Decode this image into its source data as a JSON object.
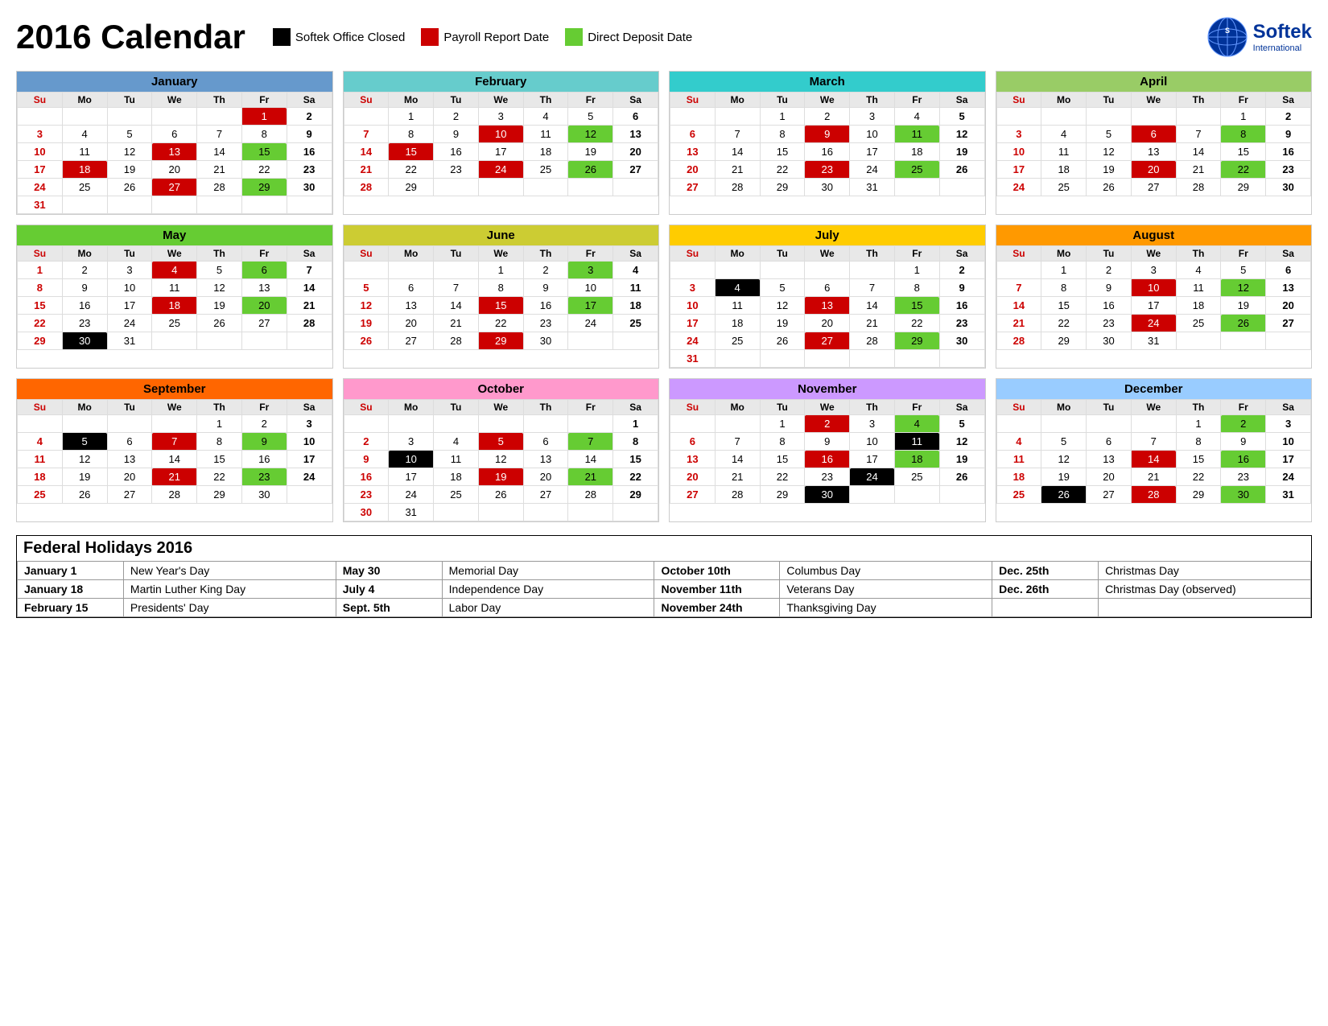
{
  "header": {
    "title": "2016 Calendar",
    "legend": [
      {
        "label": "Softek Office Closed",
        "color_class": "legend-black"
      },
      {
        "label": "Payroll Report Date",
        "color_class": "legend-red"
      },
      {
        "label": "Direct Deposit Date",
        "color_class": "legend-green"
      }
    ],
    "logo_text": "Softek",
    "logo_sub": "International"
  },
  "months": [
    {
      "name": "January",
      "class": "month-jan",
      "days_header": [
        "Su",
        "Mo",
        "Tu",
        "We",
        "Th",
        "Fr",
        "Sa"
      ],
      "weeks": [
        [
          "",
          "",
          "",
          "",
          "",
          "1r",
          "2b"
        ],
        [
          "3s",
          "4",
          "5",
          "6",
          "7",
          "8",
          "9b"
        ],
        [
          "10s",
          "11",
          "12",
          "13r",
          "14",
          "15g",
          "16b"
        ],
        [
          "17s",
          "18r",
          "19",
          "20",
          "21",
          "22",
          "23b"
        ],
        [
          "24s",
          "25",
          "26",
          "27r",
          "28",
          "29g",
          "30b"
        ],
        [
          "31s",
          "",
          "",
          "",
          "",
          "",
          ""
        ]
      ]
    },
    {
      "name": "February",
      "class": "month-feb",
      "days_header": [
        "Su",
        "Mo",
        "Tu",
        "We",
        "Th",
        "Fr",
        "Sa"
      ],
      "weeks": [
        [
          "",
          "1",
          "2",
          "3",
          "4",
          "5",
          "6b"
        ],
        [
          "7s",
          "8",
          "9",
          "10r",
          "11",
          "12g",
          "13b"
        ],
        [
          "14s",
          "15r",
          "16",
          "17",
          "18",
          "19",
          "20b"
        ],
        [
          "21s",
          "22",
          "23",
          "24r",
          "25",
          "26g",
          "27b"
        ],
        [
          "28s",
          "29",
          "",
          "",
          "",
          "",
          ""
        ]
      ]
    },
    {
      "name": "March",
      "class": "month-mar",
      "days_header": [
        "Su",
        "Mo",
        "Tu",
        "We",
        "Th",
        "Fr",
        "Sa"
      ],
      "weeks": [
        [
          "",
          "",
          "1",
          "2",
          "3",
          "4",
          "5b"
        ],
        [
          "6s",
          "7",
          "8",
          "9r",
          "10",
          "11g",
          "12b"
        ],
        [
          "13s",
          "14",
          "15",
          "16",
          "17",
          "18",
          "19b"
        ],
        [
          "20s",
          "21",
          "22",
          "23r",
          "24",
          "25g",
          "26b"
        ],
        [
          "27s",
          "28",
          "29",
          "30",
          "31",
          "",
          ""
        ]
      ]
    },
    {
      "name": "April",
      "class": "month-apr",
      "days_header": [
        "Su",
        "Mo",
        "Tu",
        "We",
        "Th",
        "Fr",
        "Sa"
      ],
      "weeks": [
        [
          "",
          "",
          "",
          "",
          "",
          "1",
          "2b"
        ],
        [
          "3s",
          "4",
          "5",
          "6r",
          "7",
          "8g",
          "9b"
        ],
        [
          "10s",
          "11",
          "12",
          "13",
          "14",
          "15",
          "16b"
        ],
        [
          "17s",
          "18",
          "19",
          "20r",
          "21",
          "22g",
          "23b"
        ],
        [
          "24s",
          "25",
          "26",
          "27",
          "28",
          "29",
          "30b"
        ]
      ]
    },
    {
      "name": "May",
      "class": "month-may",
      "days_header": [
        "Su",
        "Mo",
        "Tu",
        "We",
        "Th",
        "Fr",
        "Sa"
      ],
      "weeks": [
        [
          "1s",
          "2",
          "3",
          "4r",
          "5",
          "6g",
          "7b"
        ],
        [
          "8s",
          "9",
          "10",
          "11",
          "12",
          "13",
          "14b"
        ],
        [
          "15s",
          "16",
          "17",
          "18r",
          "19",
          "20g",
          "21b"
        ],
        [
          "22s",
          "23",
          "24",
          "25",
          "26",
          "27",
          "28b"
        ],
        [
          "29s",
          "30k",
          "31",
          "",
          "",
          "",
          ""
        ]
      ]
    },
    {
      "name": "June",
      "class": "month-jun",
      "days_header": [
        "Su",
        "Mo",
        "Tu",
        "We",
        "Th",
        "Fr",
        "Sa"
      ],
      "weeks": [
        [
          "",
          "",
          "",
          "1",
          "2",
          "3g",
          "4b"
        ],
        [
          "5s",
          "6",
          "7",
          "8",
          "9",
          "10",
          "11b"
        ],
        [
          "12s",
          "13",
          "14",
          "15r",
          "16",
          "17g",
          "18b"
        ],
        [
          "19s",
          "20",
          "21",
          "22",
          "23",
          "24",
          "25b"
        ],
        [
          "26s",
          "27",
          "28",
          "29r",
          "30",
          "",
          ""
        ]
      ]
    },
    {
      "name": "July",
      "class": "month-jul",
      "days_header": [
        "Su",
        "Mo",
        "Tu",
        "We",
        "Th",
        "Fr",
        "Sa"
      ],
      "weeks": [
        [
          "",
          "",
          "",
          "",
          "",
          "1",
          "2b"
        ],
        [
          "3s",
          "4k",
          "5",
          "6",
          "7",
          "8",
          "9b"
        ],
        [
          "10s",
          "11",
          "12",
          "13r",
          "14",
          "15g",
          "16b"
        ],
        [
          "17s",
          "18",
          "19",
          "20",
          "21",
          "22",
          "23b"
        ],
        [
          "24s",
          "25",
          "26",
          "27r",
          "28",
          "29g",
          "30b"
        ],
        [
          "31s",
          "",
          "",
          "",
          "",
          "",
          ""
        ]
      ]
    },
    {
      "name": "August",
      "class": "month-aug",
      "days_header": [
        "Su",
        "Mo",
        "Tu",
        "We",
        "Th",
        "Fr",
        "Sa"
      ],
      "weeks": [
        [
          "",
          "1",
          "2",
          "3",
          "4",
          "5",
          "6b"
        ],
        [
          "7s",
          "8",
          "9",
          "10r",
          "11",
          "12g",
          "13b"
        ],
        [
          "14s",
          "15",
          "16",
          "17",
          "18",
          "19",
          "20b"
        ],
        [
          "21s",
          "22",
          "23",
          "24r",
          "25",
          "26g",
          "27b"
        ],
        [
          "28s",
          "29",
          "30",
          "31",
          "",
          "",
          ""
        ]
      ]
    },
    {
      "name": "September",
      "class": "month-sep",
      "days_header": [
        "Su",
        "Mo",
        "Tu",
        "We",
        "Th",
        "Fr",
        "Sa"
      ],
      "weeks": [
        [
          "",
          "",
          "",
          "",
          "1",
          "2",
          "3b"
        ],
        [
          "4s",
          "5k",
          "6",
          "7r",
          "8",
          "9g",
          "10b"
        ],
        [
          "11s",
          "12",
          "13",
          "14",
          "15",
          "16",
          "17b"
        ],
        [
          "18s",
          "19",
          "20",
          "21r",
          "22",
          "23g",
          "24b"
        ],
        [
          "25s",
          "26",
          "27",
          "28",
          "29",
          "30",
          ""
        ]
      ]
    },
    {
      "name": "October",
      "class": "month-oct",
      "days_header": [
        "Su",
        "Mo",
        "Tu",
        "We",
        "Th",
        "Fr",
        "Sa"
      ],
      "weeks": [
        [
          "",
          "",
          "",
          "",
          "",
          "",
          "1b"
        ],
        [
          "2s",
          "3",
          "4",
          "5r",
          "6",
          "7g",
          "8b"
        ],
        [
          "9s",
          "10k",
          "11",
          "12",
          "13",
          "14",
          "15b"
        ],
        [
          "16s",
          "17",
          "18",
          "19r",
          "20",
          "21g",
          "22b"
        ],
        [
          "23s",
          "24",
          "25",
          "26",
          "27",
          "28",
          "29b"
        ],
        [
          "30s",
          "31",
          "",
          "",
          "",
          "",
          ""
        ]
      ]
    },
    {
      "name": "November",
      "class": "month-nov",
      "days_header": [
        "Su",
        "Mo",
        "Tu",
        "We",
        "Th",
        "Fr",
        "Sa"
      ],
      "weeks": [
        [
          "",
          "",
          "1",
          "2r",
          "3",
          "4g",
          "5b"
        ],
        [
          "6s",
          "7",
          "8",
          "9",
          "10",
          "11k",
          "12b"
        ],
        [
          "13s",
          "14",
          "15",
          "16r",
          "17",
          "18g",
          "19b"
        ],
        [
          "20s",
          "21",
          "22",
          "23",
          "24k",
          "25",
          "26b"
        ],
        [
          "27s",
          "28",
          "29",
          "30k",
          "",
          "",
          ""
        ]
      ]
    },
    {
      "name": "December",
      "class": "month-dec",
      "days_header": [
        "Su",
        "Mo",
        "Tu",
        "We",
        "Th",
        "Fr",
        "Sa"
      ],
      "weeks": [
        [
          "",
          "",
          "",
          "",
          "1",
          "2g",
          "3b"
        ],
        [
          "4s",
          "5",
          "6",
          "7",
          "8",
          "9",
          "10b"
        ],
        [
          "11s",
          "12",
          "13",
          "14r",
          "15",
          "16g",
          "17b"
        ],
        [
          "18s",
          "19",
          "20",
          "21",
          "22",
          "23",
          "24b"
        ],
        [
          "25s",
          "26k",
          "27",
          "28r",
          "29",
          "30g",
          "31b"
        ]
      ]
    }
  ],
  "holidays_title": "Federal Holidays 2016",
  "holidays": [
    [
      {
        "date": "January 1",
        "name": "New Year's Day"
      },
      {
        "date": "May 30",
        "name": "Memorial Day"
      },
      {
        "date": "October 10th",
        "name": "Columbus Day"
      },
      {
        "date": "Dec. 25th",
        "name": "Christmas Day"
      }
    ],
    [
      {
        "date": "January 18",
        "name": "Martin Luther King Day"
      },
      {
        "date": "July 4",
        "name": "Independence Day"
      },
      {
        "date": "November 11th",
        "name": "Veterans Day"
      },
      {
        "date": "Dec. 26th",
        "name": "Christmas Day (observed)"
      }
    ],
    [
      {
        "date": "February 15",
        "name": "Presidents' Day"
      },
      {
        "date": "Sept. 5th",
        "name": "Labor Day"
      },
      {
        "date": "November 24th",
        "name": "Thanksgiving Day"
      },
      {
        "date": "",
        "name": ""
      }
    ]
  ]
}
